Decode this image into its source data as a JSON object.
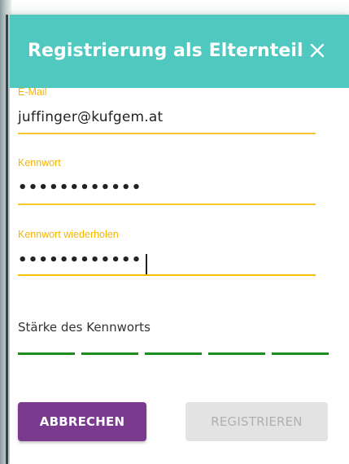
{
  "dialog": {
    "title": "Registrierung als Elternteil",
    "close_icon": "close-icon"
  },
  "fields": {
    "email": {
      "label": "E-Mail",
      "value": "juffinger@kufgem.at"
    },
    "password": {
      "label": "Kennwort",
      "value": "••••••••••••"
    },
    "password_repeat": {
      "label": "Kennwort wiederholen",
      "value": "••••••••••••"
    }
  },
  "strength": {
    "label": "Stärke des Kennworts",
    "bars_filled": 5,
    "bars_total": 5,
    "color": "#1d8f1d"
  },
  "buttons": {
    "cancel": "ABBRECHEN",
    "register": "REGISTRIEREN"
  },
  "colors": {
    "header": "#4fc9bf",
    "accent": "#f5b400",
    "primary_button": "#7a3b8f",
    "disabled_button": "#e3e3e3"
  }
}
